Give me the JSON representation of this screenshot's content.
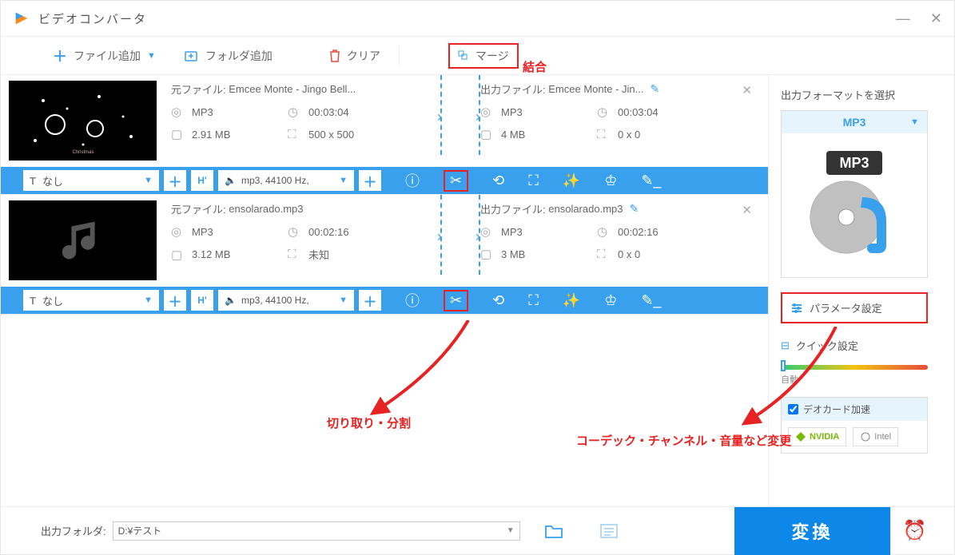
{
  "app": {
    "title": "ビデオコンバータ"
  },
  "toolbar": {
    "add_file": "ファイル追加",
    "add_folder": "フォルダ追加",
    "clear": "クリア",
    "merge": "マージ"
  },
  "annotations": {
    "merge": "結合",
    "cut": "切り取り・分割",
    "codec": "コーデック・チャンネル・音量など変更"
  },
  "items": [
    {
      "source_label": "元ファイル:",
      "source_name": "Emcee Monte - Jingo Bell...",
      "output_label": "出力ファイル:",
      "output_name": "Emcee Monte - Jin...",
      "src_fmt": "MP3",
      "src_dur": "00:03:04",
      "src_size": "2.91 MB",
      "src_dim": "500 x 500",
      "out_fmt": "MP3",
      "out_dur": "00:03:04",
      "out_size": "4 MB",
      "out_dim": "0 x 0",
      "subtitle": "なし",
      "codec": "mp3, 44100 Hz,"
    },
    {
      "source_label": "元ファイル:",
      "source_name": "ensolarado.mp3",
      "output_label": "出力ファイル:",
      "output_name": "ensolarado.mp3",
      "src_fmt": "MP3",
      "src_dur": "00:02:16",
      "src_size": "3.12 MB",
      "src_dim": "未知",
      "out_fmt": "MP3",
      "out_dur": "00:02:16",
      "out_size": "3 MB",
      "out_dim": "0 x 0",
      "subtitle": "なし",
      "codec": "mp3, 44100 Hz,"
    }
  ],
  "side": {
    "title": "出力フォーマットを選択",
    "format": "MP3",
    "mp3_label": "MP3",
    "param": "パラメータ設定",
    "quick": "クイック設定",
    "auto": "自動",
    "hw": "デオカード加速",
    "nvidia": "NVIDIA",
    "intel": "Intel"
  },
  "footer": {
    "label": "出力フォルダ:",
    "path": "D:¥テスト",
    "convert": "変換"
  }
}
